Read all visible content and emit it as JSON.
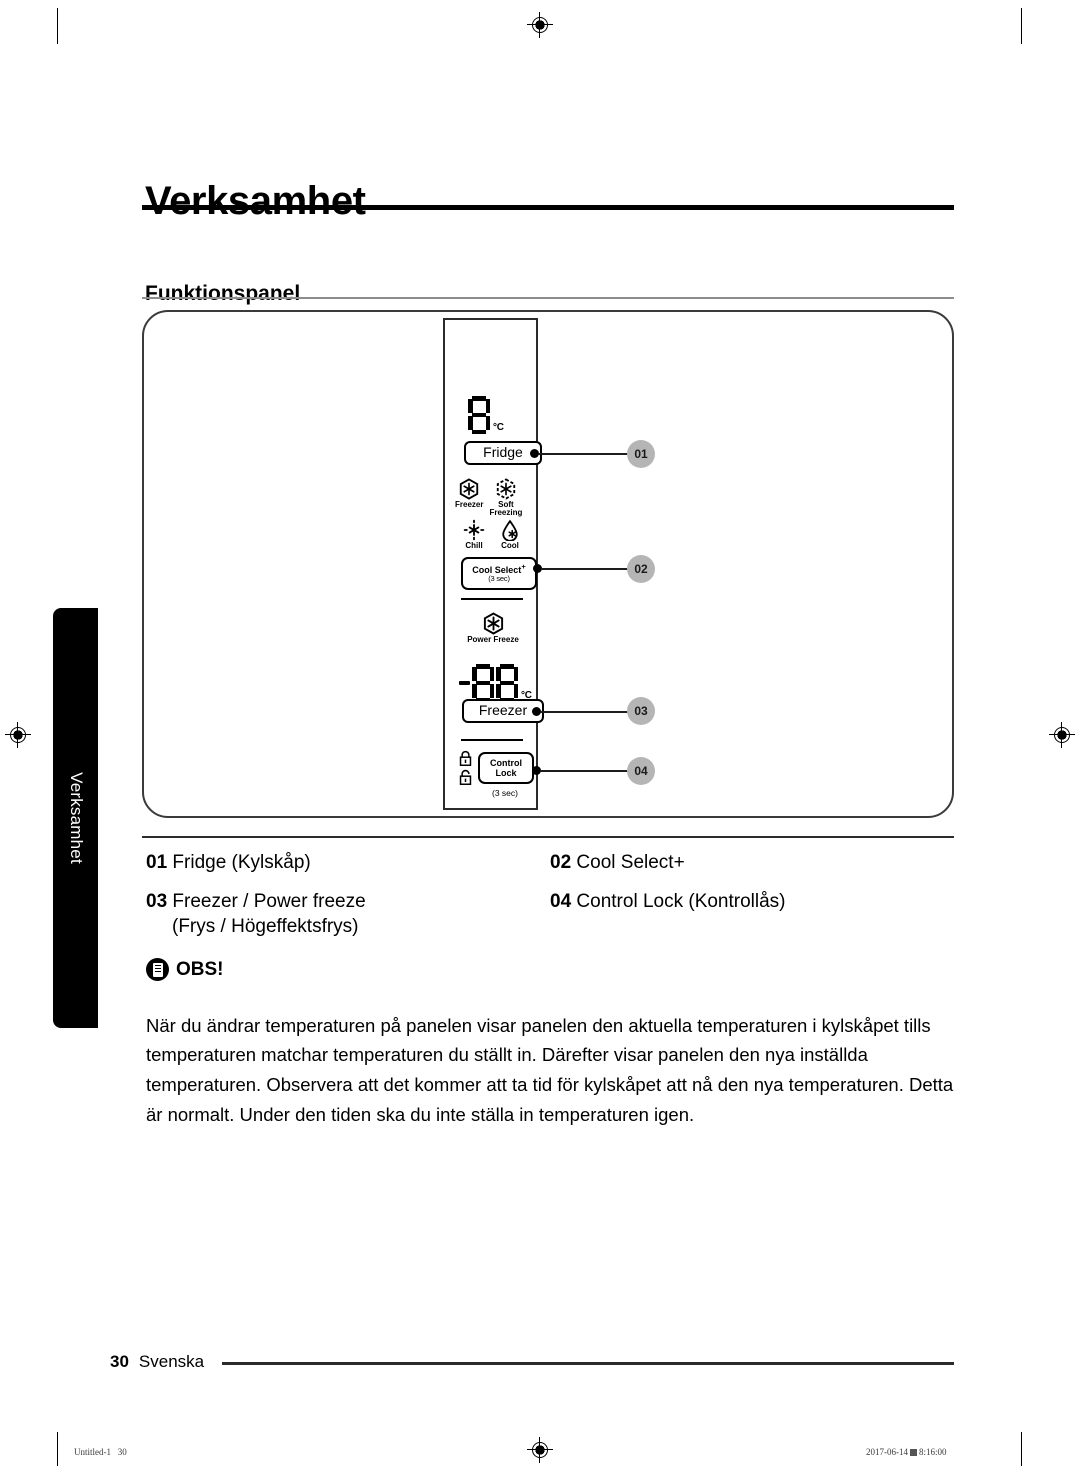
{
  "document": {
    "chapter_title": "Verksamhet",
    "side_tab_label": "Verksamhet",
    "section_title": "Funktionspanel"
  },
  "panel": {
    "fridge": {
      "display_value": "8",
      "display_unit": "°C",
      "button_label": "Fridge"
    },
    "modes": [
      {
        "label": "Freezer",
        "icon": "hexagon-snowflake-icon"
      },
      {
        "label": "Soft\nFreezing",
        "icon": "hexagon-dashed-snowflake-icon"
      },
      {
        "label": "Chill",
        "icon": "dashed-star-icon"
      },
      {
        "label": "Cool",
        "icon": "droplet-snowflake-icon"
      }
    ],
    "mode_labels": {
      "freezer": "Freezer",
      "soft_freezing_line1": "Soft",
      "soft_freezing_line2": "Freezing",
      "chill": "Chill",
      "cool": "Cool"
    },
    "cool_select": {
      "label": "Cool Select",
      "superscript": "+",
      "hold_note": "(3 sec)"
    },
    "power_freeze": {
      "label": "Power Freeze",
      "icon": "hexagon-snowflake-icon"
    },
    "freezer": {
      "display_sign": "-",
      "display_value": "88",
      "display_unit": "°C",
      "button_label": "Freezer"
    },
    "control_lock": {
      "label_line1": "Control",
      "label_line2": "Lock",
      "hold_note": "(3 sec)",
      "locked_icon": "padlock-closed-icon",
      "unlocked_icon": "padlock-open-icon"
    },
    "callouts": [
      {
        "id": "01"
      },
      {
        "id": "02"
      },
      {
        "id": "03"
      },
      {
        "id": "04"
      }
    ]
  },
  "legend": {
    "left": [
      {
        "num": "01",
        "text": "Fridge (Kylskåp)",
        "cont": ""
      },
      {
        "num": "03",
        "text": "Freezer / Power freeze",
        "cont": "(Frys / Högeffektsfrys)"
      }
    ],
    "right": [
      {
        "num": "02",
        "text": "Cool Select+",
        "cont": ""
      },
      {
        "num": "04",
        "text": "Control Lock (Kontrollås)",
        "cont": ""
      }
    ]
  },
  "note": {
    "icon": "note-document-icon",
    "heading": "OBS!",
    "body": "När du ändrar temperaturen på panelen visar panelen den aktuella temperaturen i kylskåpet tills temperaturen matchar temperaturen du ställt in. Därefter visar panelen den nya inställda temperaturen. Observera att det kommer att ta tid för kylskåpet att nå den nya temperaturen. Detta är normalt. Under den tiden ska du inte ställa in temperaturen igen."
  },
  "footer": {
    "page_number": "30",
    "language": "Svenska"
  },
  "print_marks": {
    "file_name": "Untitled-1",
    "file_page": "30",
    "date": "2017-06-14",
    "time": "8:16:00"
  }
}
